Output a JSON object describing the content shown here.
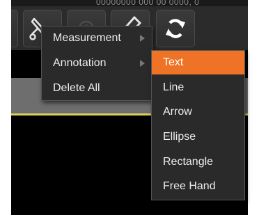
{
  "toolbar": {
    "top_text": "00000000 000 00 0000, 0",
    "buttons": [
      {
        "icon": "toolbar-partial-icon"
      },
      {
        "icon": "pencil-tool-icon"
      },
      {
        "icon": "disabled-tool-icon"
      },
      {
        "icon": "edit-tool-icon"
      },
      {
        "icon": "refresh-icon"
      }
    ]
  },
  "context_menu": {
    "items": [
      {
        "label": "Measurement",
        "has_submenu": true
      },
      {
        "label": "Annotation",
        "has_submenu": true
      },
      {
        "label": "Delete All",
        "has_submenu": false
      }
    ]
  },
  "annotation_submenu": {
    "items": [
      {
        "label": "Text",
        "selected": true
      },
      {
        "label": "Line",
        "selected": false
      },
      {
        "label": "Arrow",
        "selected": false
      },
      {
        "label": "Ellipse",
        "selected": false
      },
      {
        "label": "Rectangle",
        "selected": false
      },
      {
        "label": "Free Hand",
        "selected": false
      }
    ]
  },
  "colors": {
    "highlight": "#ee7326",
    "menu_bg": "#2a2a2a",
    "viewer_bar": "#6e6e6e",
    "viewer_line": "#d9cf5a"
  }
}
